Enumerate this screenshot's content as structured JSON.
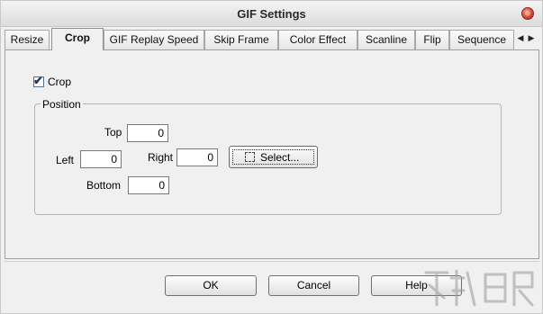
{
  "window": {
    "title": "GIF Settings"
  },
  "tabs": [
    {
      "label": "Resize"
    },
    {
      "label": "Crop"
    },
    {
      "label": "GIF Replay Speed"
    },
    {
      "label": "Skip Frame"
    },
    {
      "label": "Color Effect"
    },
    {
      "label": "Scanline"
    },
    {
      "label": "Flip"
    },
    {
      "label": "Sequence"
    }
  ],
  "active_tab": "Crop",
  "tab_scroll": {
    "left": "◀",
    "right": "▶"
  },
  "crop": {
    "checkbox_label": "Crop",
    "checked": true,
    "check_glyph": "✔",
    "group_label": "Position",
    "top_label": "Top",
    "top_value": "0",
    "left_label": "Left",
    "left_value": "0",
    "right_label": "Right",
    "right_value": "0",
    "bottom_label": "Bottom",
    "bottom_value": "0",
    "select_button": "Select..."
  },
  "buttons": {
    "ok": "OK",
    "cancel": "Cancel",
    "help": "Help"
  },
  "colors": {
    "close": "#d2452f",
    "dialog_bg": "#f0f0f0"
  }
}
